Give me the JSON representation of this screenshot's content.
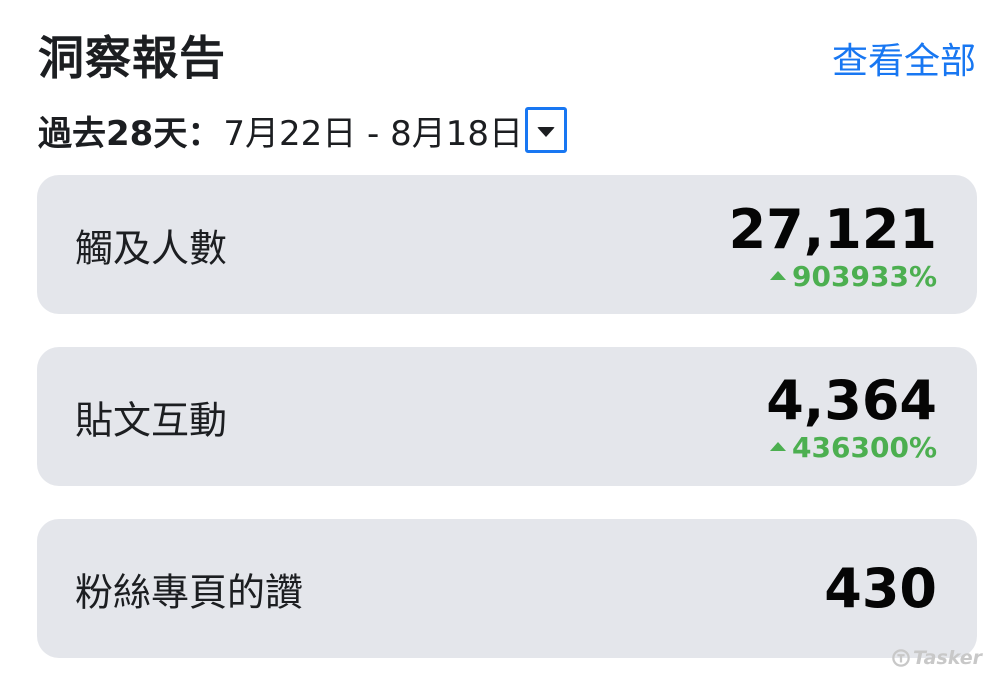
{
  "header": {
    "title": "洞察報告",
    "see_all": "查看全部"
  },
  "date_filter": {
    "prefix": "過去28天：",
    "range": "7月22日 - 8月18日",
    "dropdown_icon": "caret-down-icon"
  },
  "metrics": [
    {
      "label": "觸及人數",
      "value": "27,121",
      "change": "903933%",
      "trend": "up"
    },
    {
      "label": "貼文互動",
      "value": "4,364",
      "change": "436300%",
      "trend": "up"
    },
    {
      "label": "粉絲專頁的讚",
      "value": "430"
    }
  ],
  "watermark": "Tasker",
  "colors": {
    "accent": "#1877f2",
    "positive": "#4caf50",
    "card_bg": "#e4e6eb",
    "text": "#1c1e21"
  }
}
